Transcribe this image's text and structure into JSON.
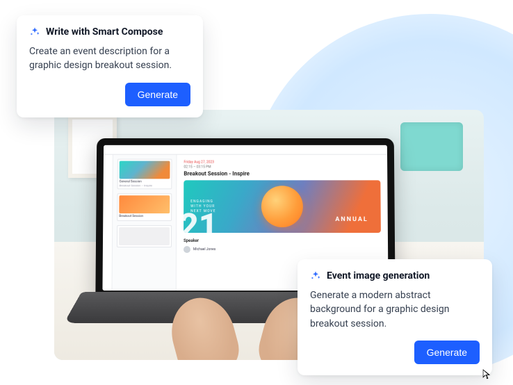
{
  "compose_card": {
    "title": "Write with Smart Compose",
    "prompt": "Create an event description for a graphic design breakout session.",
    "button": "Generate"
  },
  "image_card": {
    "title": "Event image generation",
    "prompt": "Generate a modern abstract background for a graphic design breakout session.",
    "button": "Generate"
  },
  "laptop_app": {
    "date": "Friday Aug 27, 2023",
    "time": "02:15 – 03:15 PM",
    "title": "Breakout Session - Inspire",
    "hero_line1": "ENGAGING",
    "hero_line2": "WITH YOUR",
    "hero_line3": "NEXT MOVE",
    "hero_banner": "ANNUAL",
    "speaker_label": "Speaker",
    "speaker_name": "Michael Jones",
    "thumbs": [
      {
        "title": "General Session",
        "sub": "Breakout Session – Inspire"
      },
      {
        "title": "Breakout Session",
        "sub": ""
      },
      {
        "title": "",
        "sub": ""
      }
    ]
  },
  "colors": {
    "accent_blue": "#1d5fff"
  }
}
